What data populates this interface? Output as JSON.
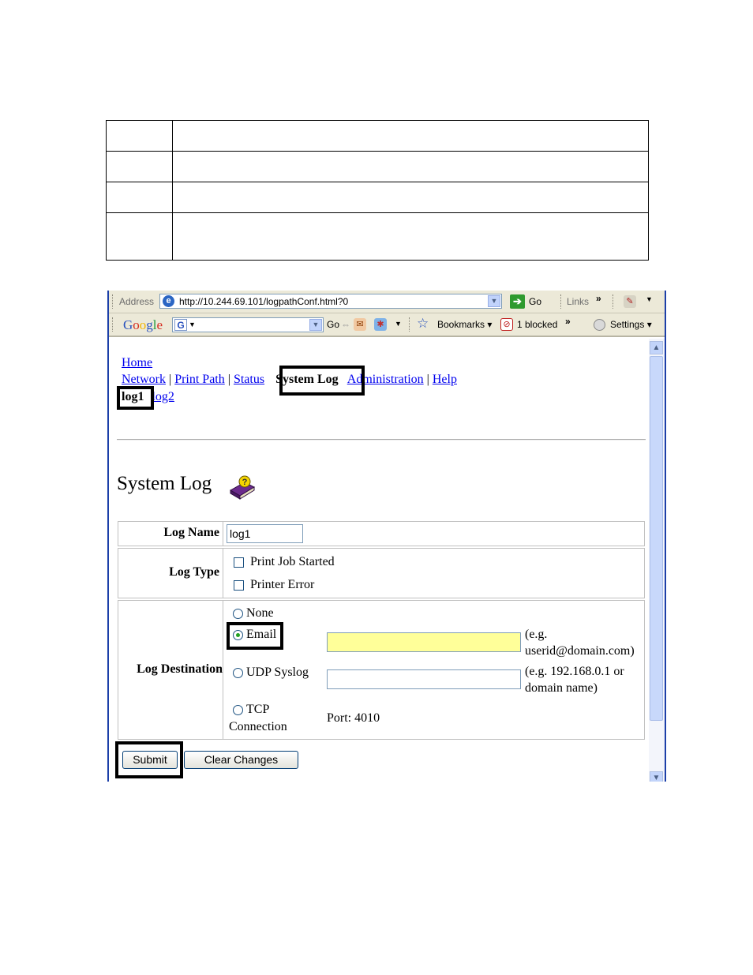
{
  "browser": {
    "address_label": "Address",
    "url": "http://10.244.69.101/logpathConf.html?0",
    "go_label": "Go",
    "links_label": "Links",
    "chevron": "»",
    "google_logo": "Google",
    "google_badge": "G",
    "search_go": "Go",
    "bookmarks_label": "Bookmarks",
    "blocked_label": "1 blocked",
    "settings_label": "Settings"
  },
  "nav": {
    "home": "Home",
    "network": "Network",
    "print_path": "Print Path",
    "status": "Status",
    "system_log": "System Log",
    "administration": "Administration",
    "help": "Help",
    "separator": "|",
    "log1": "log1",
    "log2": "log2"
  },
  "page": {
    "title": "System Log"
  },
  "form": {
    "log_name_label": "Log Name",
    "log_name_value": "log1",
    "log_type_label": "Log Type",
    "log_type_options": [
      "Print Job Started",
      "Printer Error"
    ],
    "log_destination_label": "Log Destination",
    "dest_none": "None",
    "dest_email": "Email",
    "dest_udp": "UDP Syslog",
    "dest_tcp_line1": "TCP",
    "dest_tcp_line2": "Connection",
    "email_hint_1": "(e.g.",
    "email_hint_2": "userid@domain.com)",
    "udp_hint_1": "(e.g. 192.168.0.1 or",
    "udp_hint_2": "domain name)",
    "port_text": "Port: 4010",
    "submit_label": "Submit",
    "clear_label": "Clear Changes"
  },
  "colors": {
    "highlight_input": "#ffff99",
    "link": "#0000ee"
  }
}
